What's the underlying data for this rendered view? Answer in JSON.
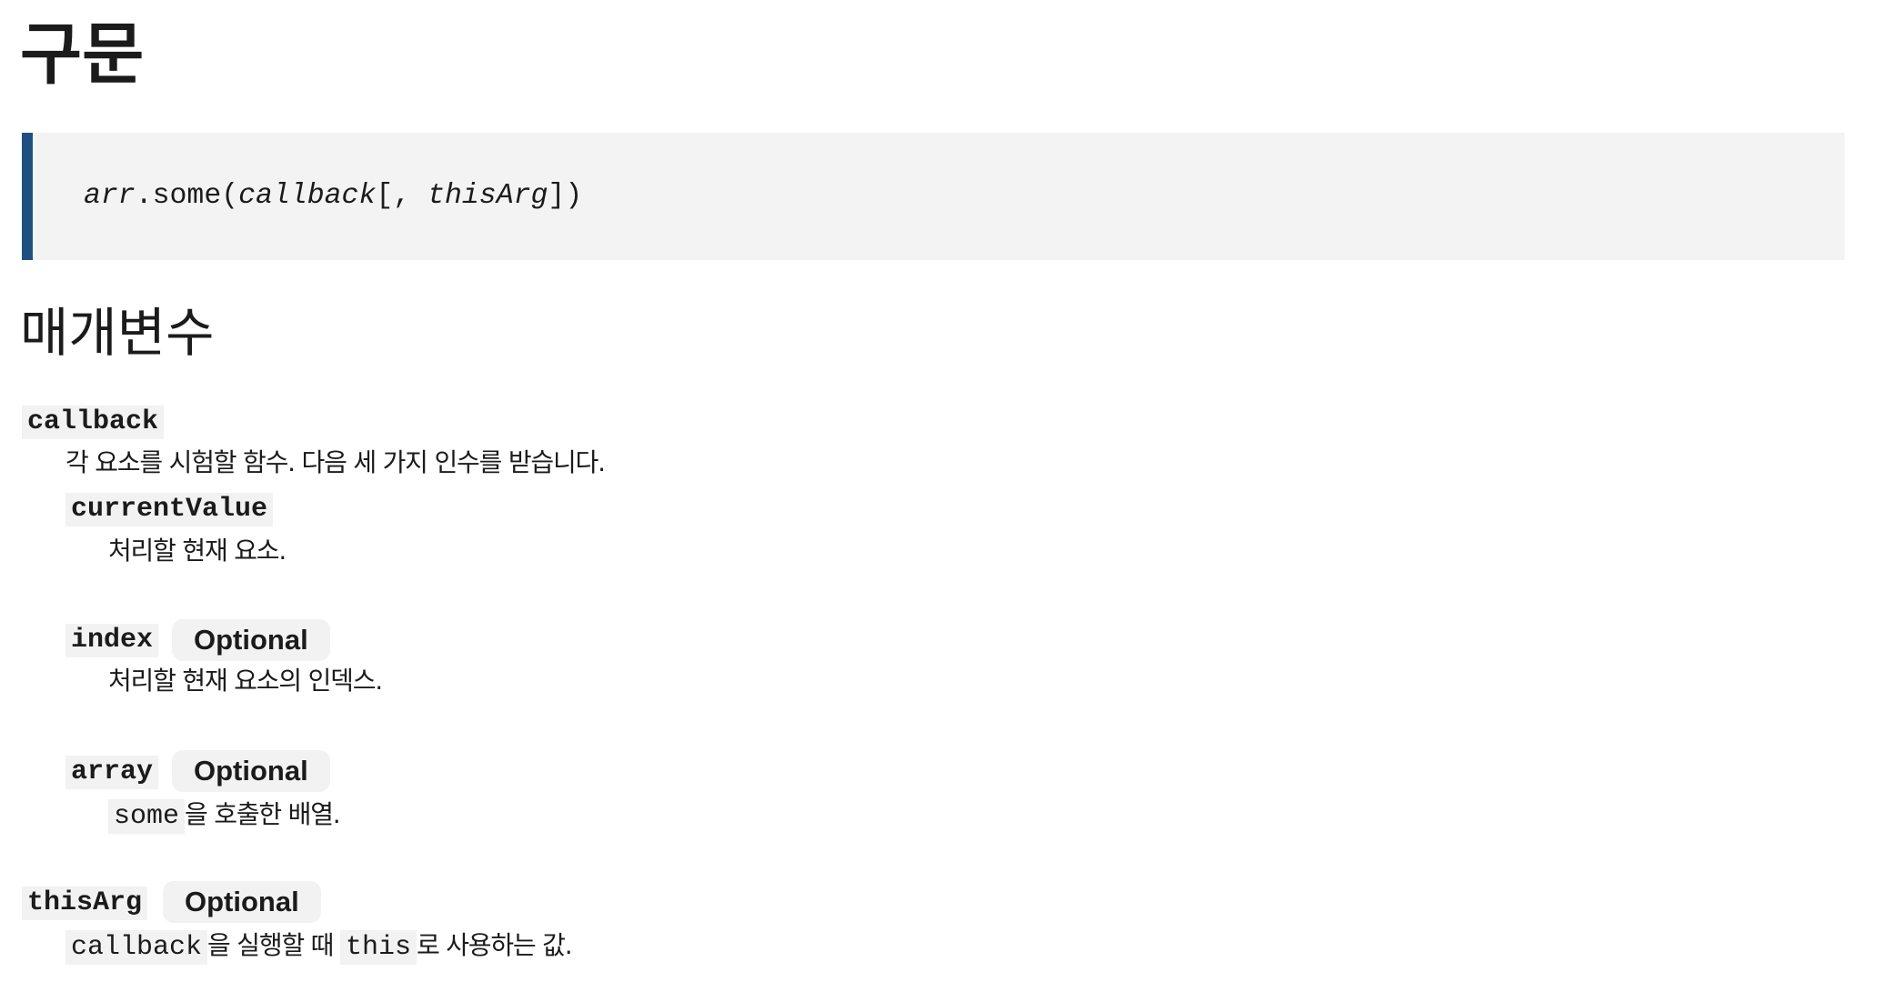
{
  "title": "구문",
  "syntax": {
    "object": "arr",
    "method": ".some(",
    "param1": "callback",
    "open_optional": "[, ",
    "param2": "thisArg",
    "close": "])"
  },
  "parameters_heading": "매개변수",
  "parameters": {
    "callback": {
      "name": "callback",
      "description": "각 요소를 시험할 함수. 다음 세 가지 인수를 받습니다.",
      "args": {
        "currentValue": {
          "name": "currentValue",
          "description": "처리할 현재 요소."
        },
        "index": {
          "name": "index",
          "badge": "Optional",
          "description": "처리할 현재 요소의 인덱스."
        },
        "array": {
          "name": "array",
          "badge": "Optional",
          "description_code": "some",
          "description_rest": "을 호출한 배열."
        }
      }
    },
    "thisArg": {
      "name": "thisArg",
      "badge": "Optional",
      "description_code1": "callback",
      "description_text1": "을 실행할 때 ",
      "description_code2": "this",
      "description_text2": "로 사용하는 값."
    }
  },
  "colors": {
    "accent_bar": "#1f4f80",
    "code_background": "#f3f3f3",
    "text": "#1b1b1b"
  }
}
